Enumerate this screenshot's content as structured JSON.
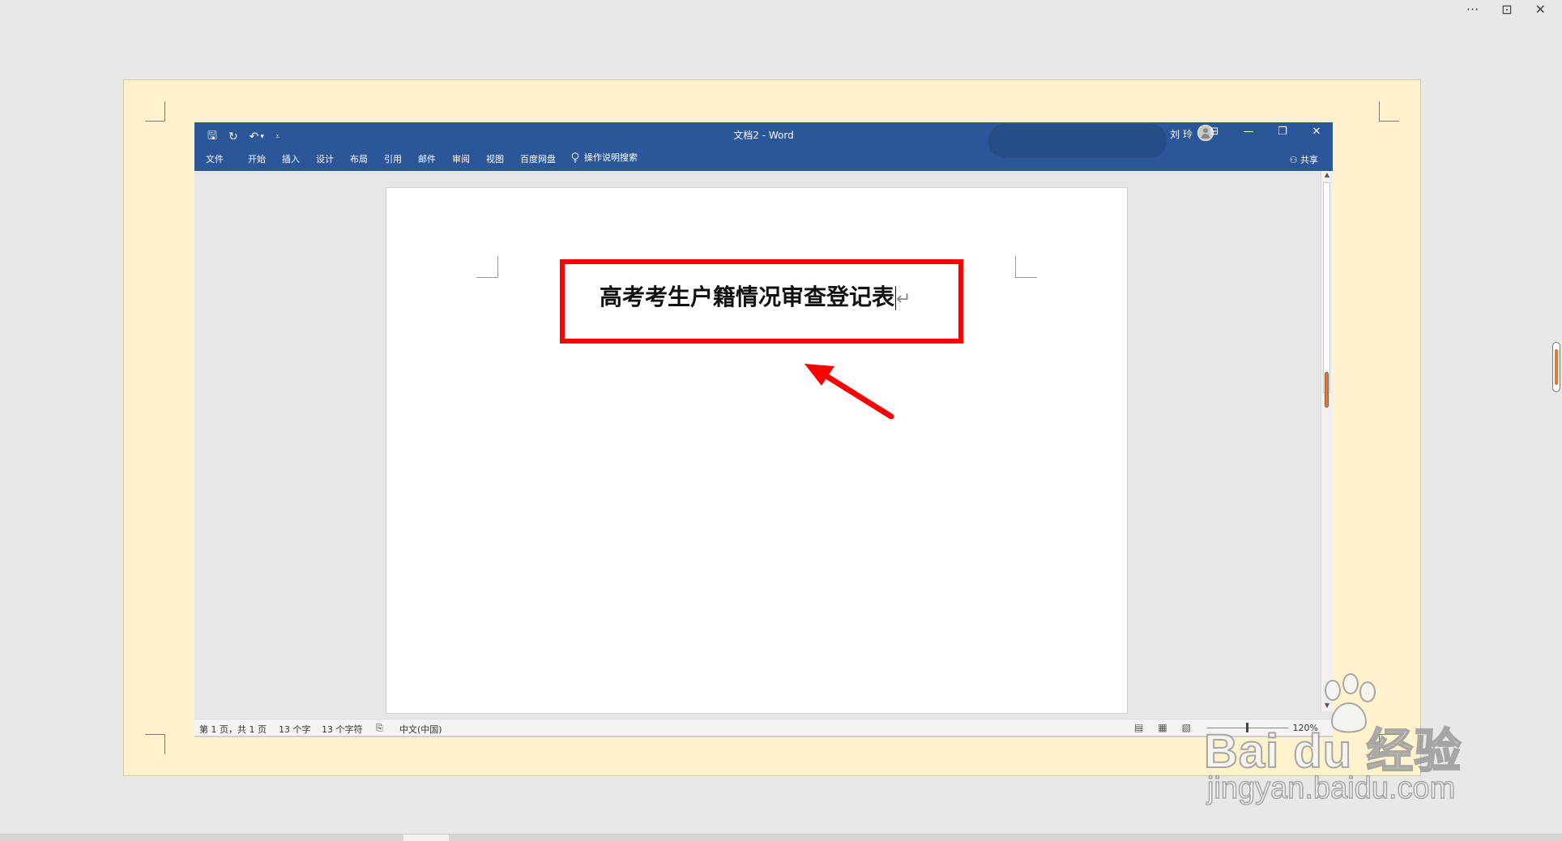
{
  "viewer": {
    "top_icons": [
      "more-icon",
      "fit-icon",
      "close-icon"
    ],
    "more_glyph": "···",
    "fit_glyph": "⊡",
    "close_glyph": "✕"
  },
  "word": {
    "title": "文档2 - Word",
    "user_name": "刘 玲",
    "tabs": [
      "文件",
      "开始",
      "插入",
      "设计",
      "布局",
      "引用",
      "邮件",
      "审阅",
      "视图",
      "百度网盘"
    ],
    "tell_me": "操作说明搜索",
    "share": "共享",
    "qat": {
      "save": "🖫",
      "redo": "↻",
      "undo": "↶",
      "undo_dropdown": "▾",
      "customize": "⩡"
    },
    "window_controls": {
      "ribbon_options": "⊟",
      "minimize": "—",
      "restore": "❐",
      "close": "✕"
    },
    "document": {
      "heading": "高考考生户籍情况审查登记表",
      "paragraph_mark": "↵"
    },
    "status": {
      "page": "第 1 页，共 1 页",
      "words": "13 个字",
      "chars": "13 个字符",
      "language": "中文(中国)",
      "zoom": "120%"
    }
  },
  "watermark": {
    "brand": "Bai  du 经验",
    "url": "jingyan.baidu.com"
  },
  "colors": {
    "ribbon": "#2b579a",
    "slide_bg": "#fff2cc",
    "highlight": "#ff0000"
  }
}
